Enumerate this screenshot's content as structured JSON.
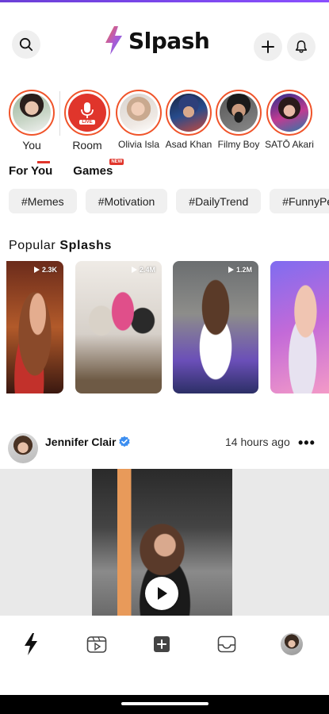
{
  "app": {
    "name": "Slpash"
  },
  "header": {
    "search_icon": "search-icon",
    "add_icon": "plus-icon",
    "bell_icon": "bell-icon"
  },
  "stories": [
    {
      "label": "You"
    },
    {
      "label": "Room",
      "badge": "LIVE"
    },
    {
      "label": "Olivia Isla"
    },
    {
      "label": "Asad Khan"
    },
    {
      "label": "Filmy Boy"
    },
    {
      "label": "SATŌ Akari"
    }
  ],
  "tabs": [
    {
      "label": "For You",
      "active": true
    },
    {
      "label": "Games",
      "badge": "NEW"
    }
  ],
  "chips": [
    "#Memes",
    "#Motivation",
    "#DailyTrend",
    "#FunnyPe"
  ],
  "popular": {
    "title_plain": "Popular",
    "title_bold": "Splashs",
    "reels": [
      {
        "views": "2.3K"
      },
      {
        "views": "2.4M"
      },
      {
        "views": "1.2M"
      },
      {
        "views": ""
      }
    ]
  },
  "post": {
    "author": "Jennifer Clair",
    "time": "14 hours ago",
    "more": "•••"
  },
  "nav": [
    "splash-icon",
    "reels-icon",
    "add-post-icon",
    "inbox-icon",
    "profile-avatar"
  ],
  "colors": {
    "accent": "#f0542a",
    "live": "#e0352b",
    "brand_purple": "#8a4fff",
    "verified": "#3c8ef0"
  }
}
